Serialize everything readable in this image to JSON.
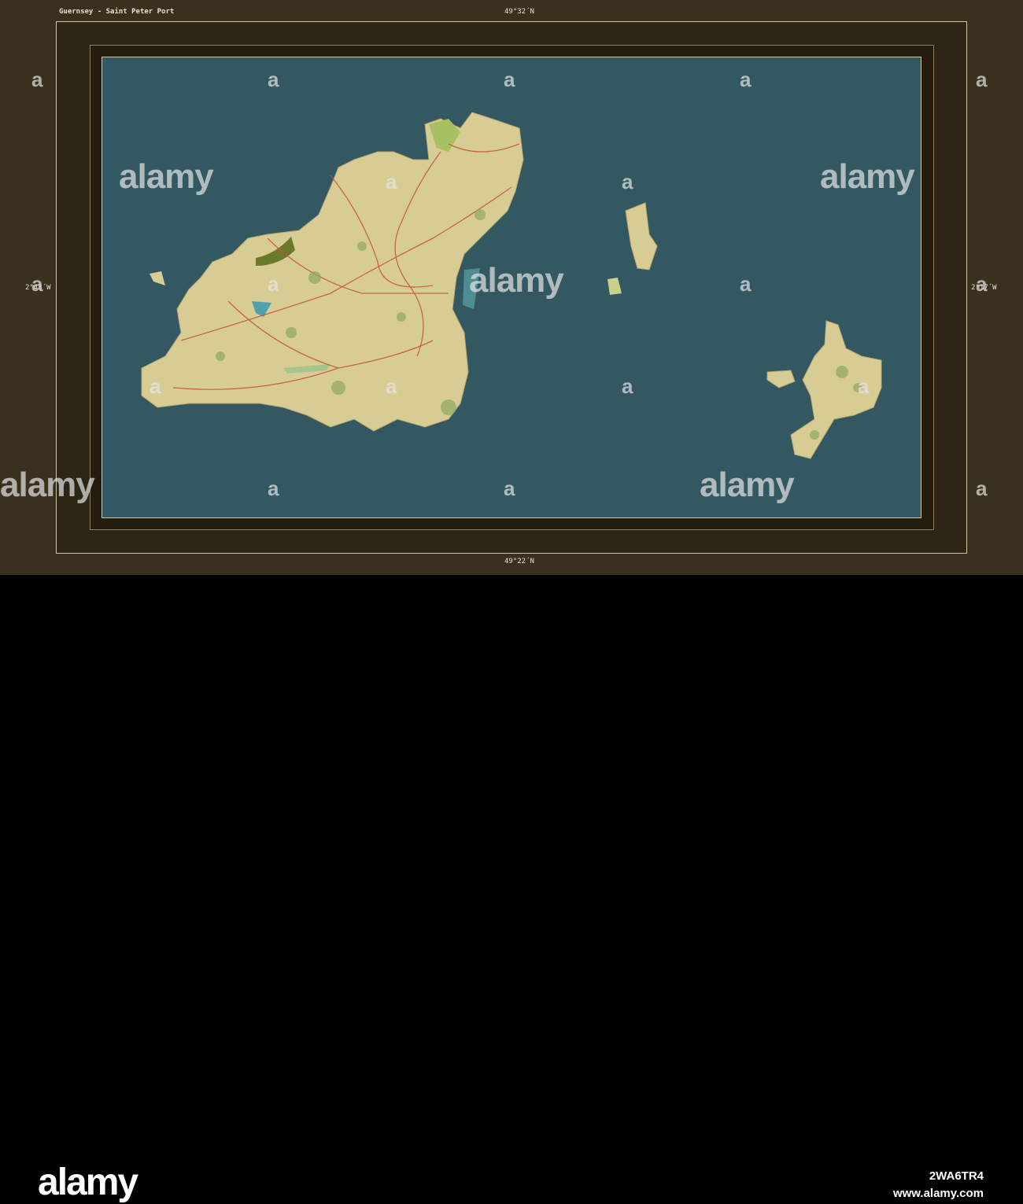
{
  "map": {
    "title": "Guernsey - Saint Peter Port",
    "lat_top": "49°32´N",
    "lat_bottom": "49°22´N",
    "lon_left": "2°43´W",
    "lon_right": "2°17´W"
  },
  "colors": {
    "sea": "#345861",
    "land": "#d6cc94",
    "roads": "#c8513f",
    "frame": "#3a301e"
  },
  "watermark": {
    "text": "alamy",
    "letter": "a"
  },
  "footer": {
    "logo": "alamy",
    "image_id": "2WA6TR4",
    "url": "www.alamy.com"
  }
}
